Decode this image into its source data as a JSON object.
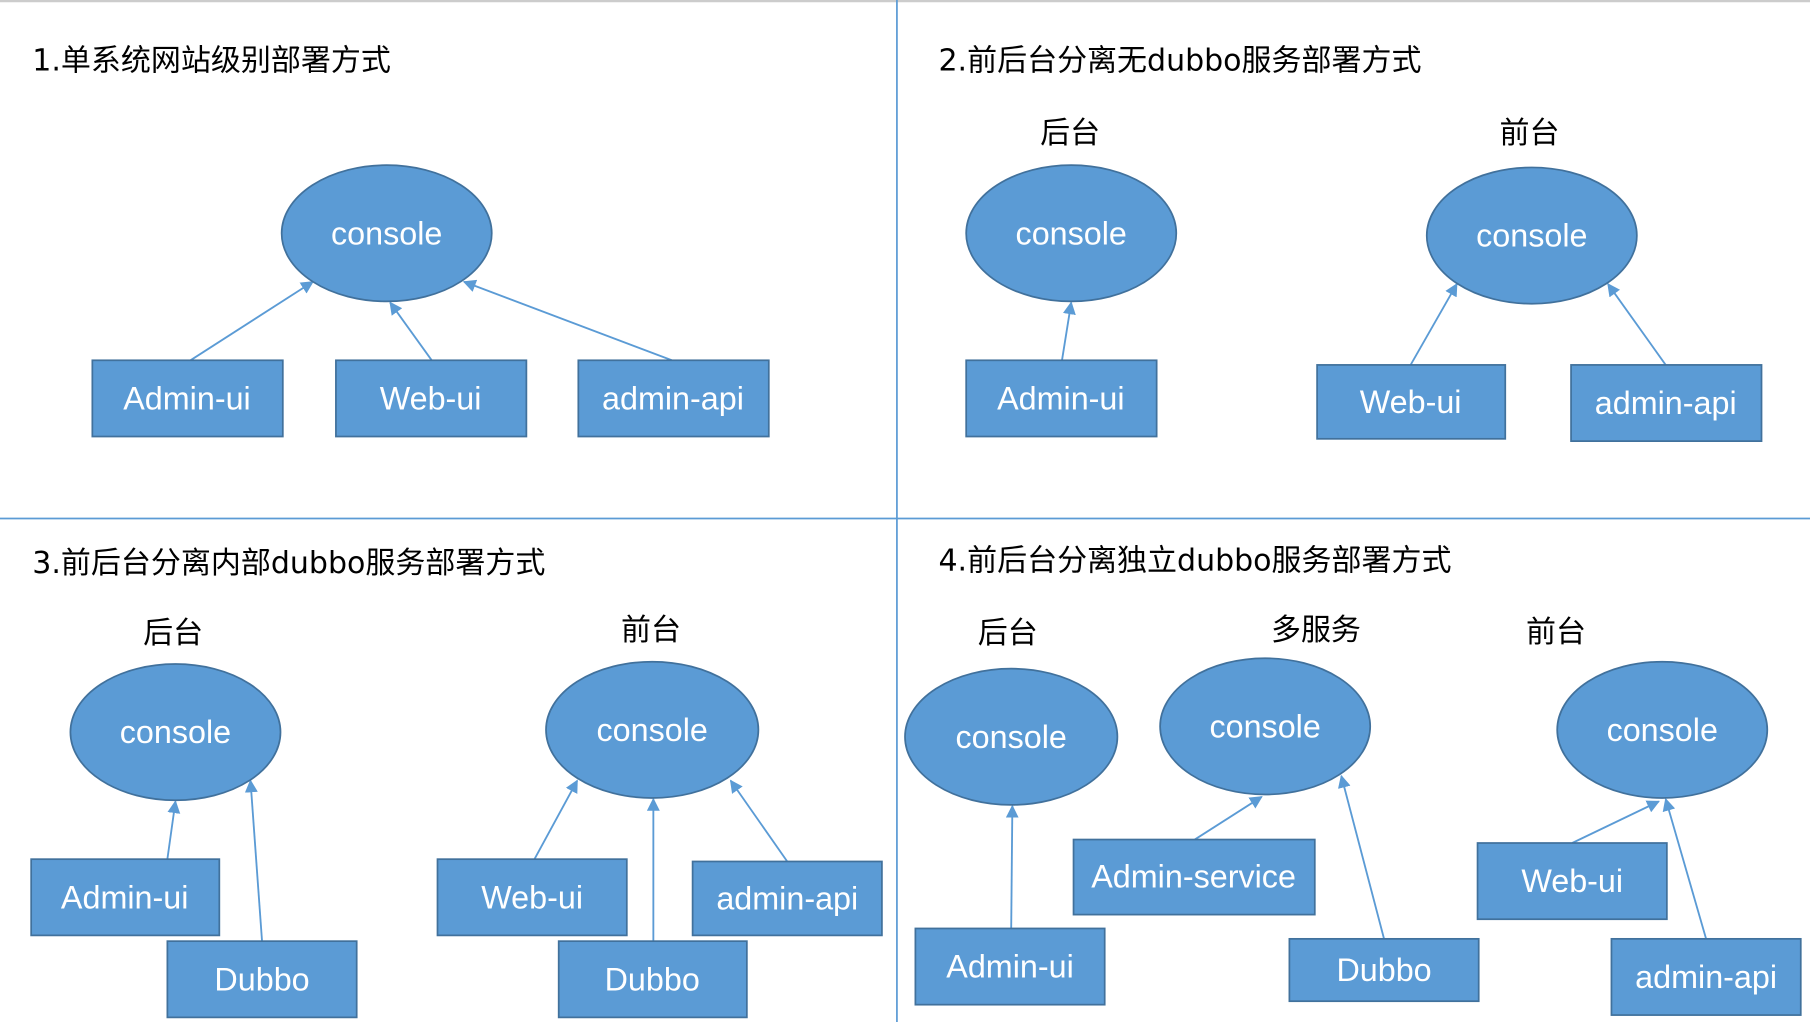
{
  "colors": {
    "node_fill": "#5b9bd5",
    "node_stroke": "#41719c",
    "edge": "#5b9bd5"
  },
  "panel1": {
    "title": "1.单系统网站级别部署方式",
    "console": "console",
    "admin_ui": "Admin-ui",
    "web_ui": "Web-ui",
    "admin_api": "admin-api"
  },
  "panel2": {
    "title": "2.前后台分离无dubbo服务部署方式",
    "backend_label": "后台",
    "frontend_label": "前台",
    "console_back": "console",
    "console_front": "console",
    "admin_ui": "Admin-ui",
    "web_ui": "Web-ui",
    "admin_api": "admin-api"
  },
  "panel3": {
    "title": "3.前后台分离内部dubbo服务部署方式",
    "backend_label": "后台",
    "frontend_label": "前台",
    "console_back": "console",
    "console_front": "console",
    "admin_ui": "Admin-ui",
    "dubbo_back": "Dubbo",
    "web_ui": "Web-ui",
    "admin_api": "admin-api",
    "dubbo_front": "Dubbo"
  },
  "panel4": {
    "title": "4.前后台分离独立dubbo服务部署方式",
    "backend_label": "后台",
    "service_label": "多服务",
    "frontend_label": "前台",
    "console_back": "console",
    "console_service": "console",
    "console_front": "console",
    "admin_service": "Admin-service",
    "admin_ui": "Admin-ui",
    "dubbo": "Dubbo",
    "web_ui": "Web-ui",
    "admin_api": "admin-api"
  }
}
